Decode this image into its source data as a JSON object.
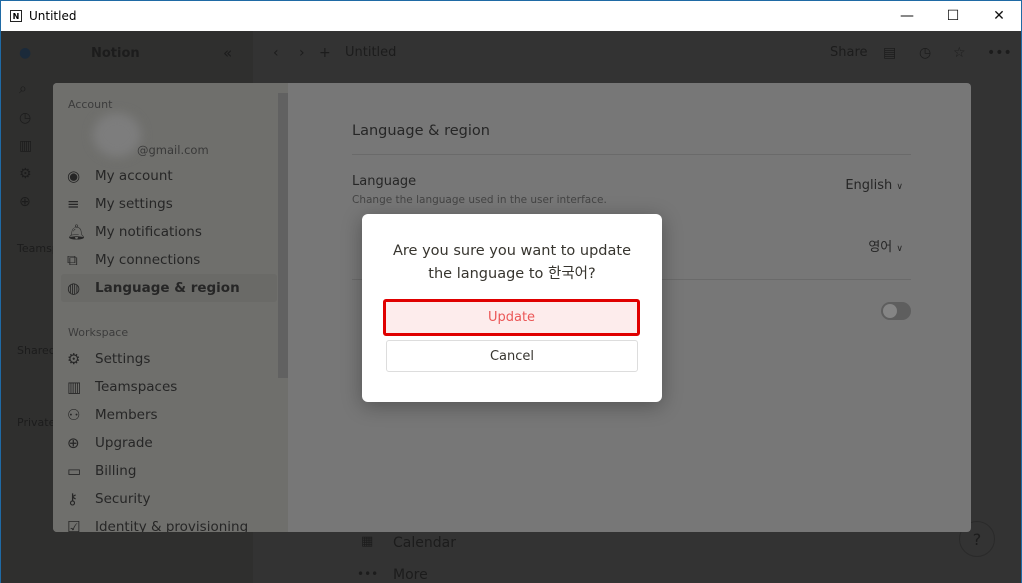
{
  "window": {
    "title": "Untitled",
    "minimize": "—",
    "maximize": "☐",
    "close": "✕"
  },
  "app_sidebar": {
    "workspace": "Notion",
    "sections": [
      "Teamspaces",
      "Shared",
      "Private"
    ]
  },
  "topbar": {
    "page_title": "Untitled",
    "share": "Share"
  },
  "background_page": {
    "items": [
      {
        "icon": "calendar-icon",
        "label": "Calendar"
      },
      {
        "icon": "more-icon",
        "label": "More"
      }
    ]
  },
  "settings": {
    "account_header": "Account",
    "email": "@gmail.com",
    "account_items": [
      {
        "icon": "user-circle-icon",
        "label": "My account"
      },
      {
        "icon": "sliders-icon",
        "label": "My settings"
      },
      {
        "icon": "bell-icon",
        "label": "My notifications"
      },
      {
        "icon": "external-link-icon",
        "label": "My connections"
      },
      {
        "icon": "globe-icon",
        "label": "Language & region",
        "active": true
      }
    ],
    "workspace_header": "Workspace",
    "workspace_items": [
      {
        "icon": "gear-icon",
        "label": "Settings"
      },
      {
        "icon": "building-icon",
        "label": "Teamspaces"
      },
      {
        "icon": "users-icon",
        "label": "Members"
      },
      {
        "icon": "upgrade-icon",
        "label": "Upgrade"
      },
      {
        "icon": "credit-card-icon",
        "label": "Billing"
      },
      {
        "icon": "key-icon",
        "label": "Security"
      },
      {
        "icon": "shield-check-icon",
        "label": "Identity & provisioning"
      }
    ],
    "pane": {
      "title": "Language & region",
      "language_label": "Language",
      "language_desc": "Change the language used in the user interface.",
      "language_value": "English",
      "row2_value": "영어"
    }
  },
  "dialog": {
    "line1": "Are you sure you want to update",
    "line2": "the language to 한국어?",
    "update": "Update",
    "cancel": "Cancel"
  },
  "help": "?"
}
